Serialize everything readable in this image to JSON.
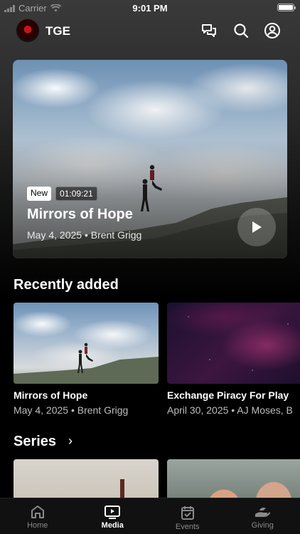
{
  "status_bar": {
    "carrier": "Carrier",
    "time": "9:01 PM"
  },
  "header": {
    "app_name": "TGE"
  },
  "hero": {
    "badge_new": "New",
    "duration": "01:09:21",
    "title": "Mirrors of Hope",
    "meta": "May 4, 2025 • Brent Grigg"
  },
  "recently_added": {
    "title": "Recently added",
    "items": [
      {
        "title": "Mirrors of Hope",
        "meta": "May 4, 2025 • Brent Grigg"
      },
      {
        "title": "Exchange Piracy For Play",
        "meta": "April 30, 2025 • AJ Moses, B"
      }
    ]
  },
  "series": {
    "title": "Series",
    "arrow": "›"
  },
  "tabs": [
    {
      "label": "Home",
      "icon": "home-icon"
    },
    {
      "label": "Media",
      "icon": "tv-play-icon"
    },
    {
      "label": "Events",
      "icon": "calendar-check-icon"
    },
    {
      "label": "Giving",
      "icon": "giving-hand-icon"
    }
  ]
}
